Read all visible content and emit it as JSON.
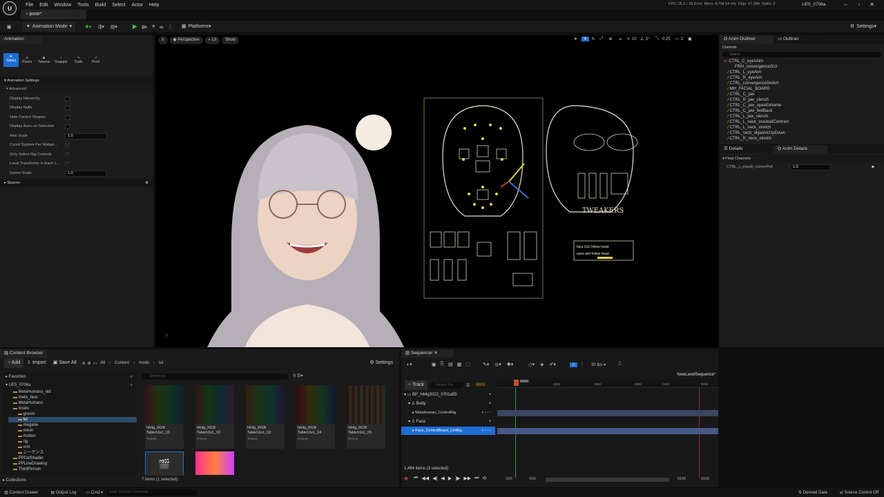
{
  "menu": [
    "File",
    "Edit",
    "Window",
    "Tools",
    "Build",
    "Select",
    "Actor",
    "Help"
  ],
  "logo_text": "U",
  "doc_tab": "pose*",
  "stats": {
    "fps": "FPS: 25.2",
    "ms": "39.8 ms",
    "mem": "Mem: 4,734.54 mb",
    "objs": "Objs: 97,384",
    "stalls": "Stalls: 3"
  },
  "project": "UE5_0706a",
  "toolbar": {
    "mode": "Animation Mode",
    "platforms": "Platforms",
    "settings": "Settings"
  },
  "anim_panel": {
    "tab": "Animation",
    "tools": [
      "Select",
      "Poses",
      "Tweens",
      "Snapper",
      "Trails",
      "Pivot"
    ],
    "section": "Animation Settings",
    "advanced": "Advanced",
    "props": [
      {
        "label": "Display Hierarchy",
        "type": "check",
        "checked": false
      },
      {
        "label": "Display Nulls",
        "type": "check",
        "checked": false
      },
      {
        "label": "Hide Control Shapes",
        "type": "check",
        "checked": false
      },
      {
        "label": "Display Axes on Selection",
        "type": "check",
        "checked": false
      },
      {
        "label": "Axis Scale",
        "type": "num",
        "value": "1.0"
      },
      {
        "label": "Coord System Per Widget...",
        "type": "check",
        "checked": true
      },
      {
        "label": "Only Select Rig Controls",
        "type": "check",
        "checked": true
      },
      {
        "label": "Local Transforms in Each L...",
        "type": "check",
        "checked": true
      },
      {
        "label": "Gizmo Scale",
        "type": "num",
        "value": "1.0"
      }
    ],
    "spaces": "Spaces"
  },
  "viewport": {
    "perspective": "Perspective",
    "lit": "Lit",
    "show": "Show",
    "grid": "10",
    "angle": "5°",
    "scale": "0.25",
    "cam": "2",
    "tweakers": "TWEAKERS",
    "board_labels": [
      "face GUI follow head",
      "eyes aim follow head"
    ]
  },
  "outliner": {
    "tabs": [
      "Anim Outliner",
      "Outliner"
    ],
    "controls": "Controls",
    "search_placeholder": "Search",
    "items": [
      "CTRL_C_eyesAim",
      "FRM_convergenceGUI",
      "CTRL_L_eyeAim",
      "CTRL_R_eyeAim",
      "CTRL_convergenceSwitch",
      "MH_FACIAL_BOARD",
      "CTRL_C_jaw",
      "CTRL_R_jaw_clench",
      "CTRL_C_jaw_openExtreme",
      "CTRL_C_jaw_fwdBack",
      "CTRL_L_jaw_clench",
      "CTRL_L_neck_mastoidContract",
      "CTRL_L_neck_stretch",
      "CTRL_neck_digastricUpDown",
      "CTRL_R_neck_stretch"
    ]
  },
  "details": {
    "tabs": [
      "Details",
      "Anim Details"
    ],
    "section": "Float Channels",
    "channel": "CTRL_L_mouth_cornerPull",
    "value": "1.0"
  },
  "content_browser": {
    "tab": "Content Browser",
    "add": "Add",
    "import": "Import",
    "save_all": "Save All",
    "path": [
      "All",
      "Content",
      "modo",
      "lut"
    ],
    "settings": "Settings",
    "favorites": "Favorites",
    "root": "UE5_0706a",
    "tree": [
      "MetaHumans_old",
      "meta_face",
      "MetaHumans",
      "modo",
      "groom",
      "lut",
      "megane",
      "mesh",
      "motion",
      "rig",
      "vrm",
      "シーケンス",
      "PPCelShader",
      "PPLineDrawing",
      "ThirdPerson"
    ],
    "search_placeholder": "Search lut",
    "assets": [
      {
        "name": "h64g_RGB Table16x1_01",
        "type": "Texture"
      },
      {
        "name": "h64g_RGB Table16x1_02",
        "type": "Texture"
      },
      {
        "name": "h64g_RGB Table16x1_03",
        "type": "Texture"
      },
      {
        "name": "h64g_RGB Table16x1_04",
        "type": "Texture"
      },
      {
        "name": "h64g_RGB Table16x1_05",
        "type": "Texture"
      }
    ],
    "count": "7 items (1 selected)",
    "collections": "Collections"
  },
  "sequencer": {
    "tab": "Sequencer",
    "fps": "30 fps",
    "sequence": "NewLevelSequence*",
    "track_btn": "Track",
    "search_placeholder": "Search Tra",
    "frame": "0000",
    "ruler": [
      "0030",
      "0060",
      "0090",
      "0120",
      "0150"
    ],
    "tracks": [
      "BP_h64g2022_0701a55",
      "Body",
      "MetaHuman_ControlRig",
      "Face",
      "Face_ControlBoard_CtrlRig"
    ],
    "items_count": "1,464 items (3 selected)",
    "range": [
      "-015",
      "-015",
      "0165",
      "0165"
    ]
  },
  "status": {
    "drawer": "Content Drawer",
    "output": "Output Log",
    "cmd": "Cmd",
    "console_placeholder": "Enter Console Command",
    "derived": "Derived Data",
    "source": "Source Control Off"
  }
}
